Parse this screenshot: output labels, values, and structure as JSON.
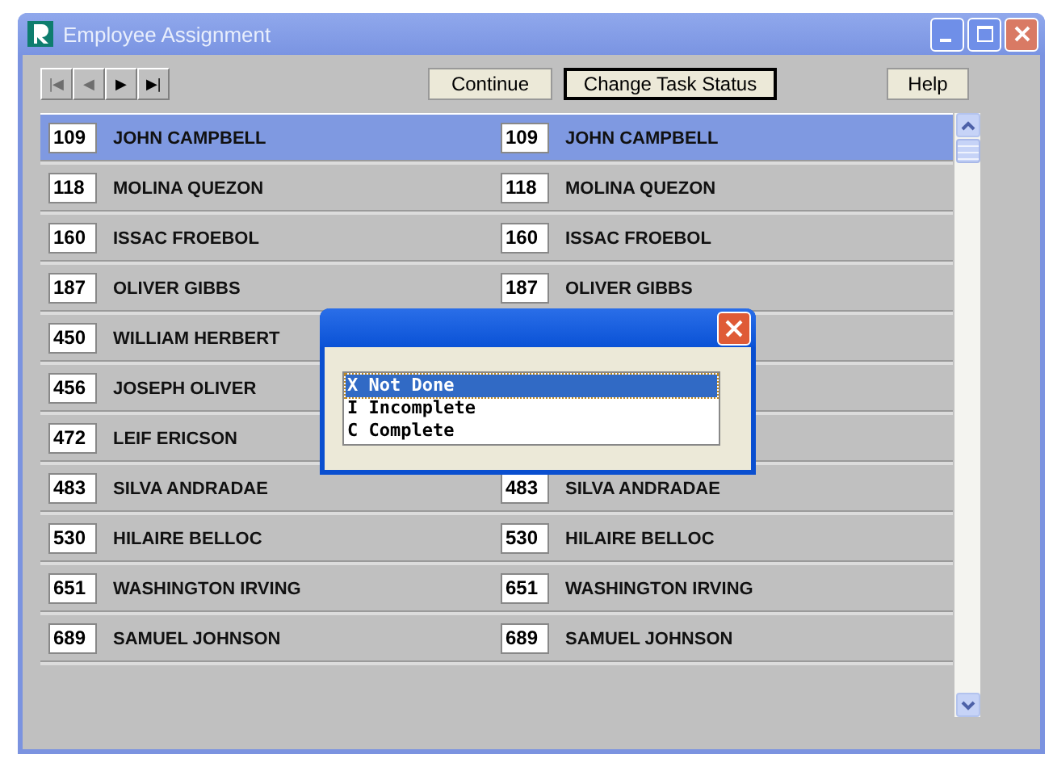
{
  "window": {
    "title": "Employee Assignment"
  },
  "nav_buttons": [
    {
      "symbol": "|◀",
      "disabled": true
    },
    {
      "symbol": "◀",
      "disabled": true
    },
    {
      "symbol": "▶",
      "disabled": false
    },
    {
      "symbol": "▶|",
      "disabled": false
    }
  ],
  "buttons": [
    {
      "label": "Continue",
      "focused": false
    },
    {
      "label": "Change Task Status",
      "focused": true
    },
    {
      "label": "Help",
      "focused": false
    }
  ],
  "rows": [
    {
      "selected": true,
      "left": {
        "id": "109",
        "name": "JOHN CAMPBELL"
      },
      "right": {
        "id": "109",
        "name": "JOHN CAMPBELL"
      }
    },
    {
      "selected": false,
      "left": {
        "id": "118",
        "name": "MOLINA QUEZON"
      },
      "right": {
        "id": "118",
        "name": "MOLINA QUEZON"
      }
    },
    {
      "selected": false,
      "left": {
        "id": "160",
        "name": "ISSAC FROEBOL"
      },
      "right": {
        "id": "160",
        "name": "ISSAC FROEBOL"
      }
    },
    {
      "selected": false,
      "left": {
        "id": "187",
        "name": "OLIVER GIBBS"
      },
      "right": {
        "id": "187",
        "name": "OLIVER GIBBS"
      }
    },
    {
      "selected": false,
      "left": {
        "id": "450",
        "name": "WILLIAM HERBERT"
      }
    },
    {
      "selected": false,
      "left": {
        "id": "456",
        "name": "JOSEPH OLIVER"
      }
    },
    {
      "selected": false,
      "left": {
        "id": "472",
        "name": "LEIF ERICSON"
      }
    },
    {
      "selected": false,
      "left": {
        "id": "483",
        "name": "SILVA ANDRADAE"
      },
      "right": {
        "id": "483",
        "name": "SILVA ANDRADAE"
      }
    },
    {
      "selected": false,
      "left": {
        "id": "530",
        "name": "HILAIRE BELLOC"
      },
      "right": {
        "id": "530",
        "name": "HILAIRE BELLOC"
      }
    },
    {
      "selected": false,
      "left": {
        "id": "651",
        "name": "WASHINGTON IRVING"
      },
      "right": {
        "id": "651",
        "name": "WASHINGTON IRVING"
      }
    },
    {
      "selected": false,
      "left": {
        "id": "689",
        "name": "SAMUEL JOHNSON"
      },
      "right": {
        "id": "689",
        "name": "SAMUEL JOHNSON"
      }
    }
  ],
  "dialog": {
    "options": [
      {
        "label": "X Not Done",
        "selected": true
      },
      {
        "label": "I Incomplete",
        "selected": false
      },
      {
        "label": "C Complete",
        "selected": false
      }
    ]
  }
}
